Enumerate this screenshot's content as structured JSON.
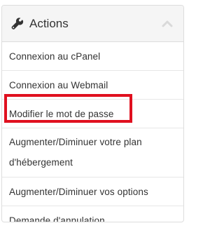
{
  "panel": {
    "title": "Actions",
    "header_icon": "wrench-icon",
    "collapse_icon": "chevron-up-icon"
  },
  "items": [
    {
      "label": "Connexion au cPanel"
    },
    {
      "label": "Connexion au Webmail"
    },
    {
      "label": "Modifier le mot de passe",
      "highlighted": true
    },
    {
      "label": "Augmenter/Diminuer votre plan d'hébergement"
    },
    {
      "label": "Augmenter/Diminuer vos options"
    },
    {
      "label": "Demande d'annulation"
    }
  ],
  "colors": {
    "highlight": "#e0101f",
    "heading_bg": "#f5f5f5",
    "border": "#dddddd",
    "text": "#333333"
  }
}
